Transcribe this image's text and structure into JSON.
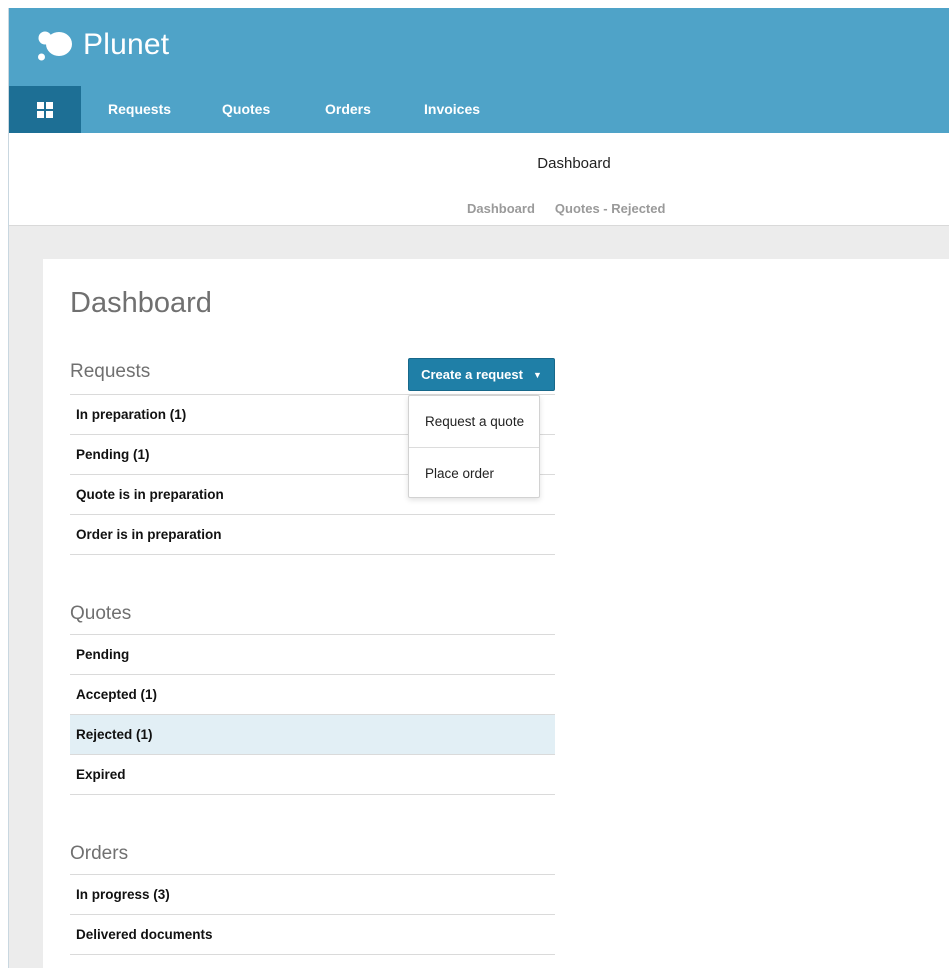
{
  "app": {
    "brand_name": "Plunet"
  },
  "nav": {
    "items": [
      {
        "label": "Requests"
      },
      {
        "label": "Quotes"
      },
      {
        "label": "Orders"
      },
      {
        "label": "Invoices"
      }
    ]
  },
  "header": {
    "title": "Dashboard",
    "breadcrumb": [
      "Dashboard",
      "Quotes - Rejected"
    ]
  },
  "main": {
    "page_title": "Dashboard",
    "create_button_label": "Create a request",
    "dropdown_items": [
      "Request a quote",
      "Place order"
    ],
    "sections": [
      {
        "title": "Requests",
        "items": [
          "In preparation (1)",
          "Pending (1)",
          "Quote is in preparation",
          "Order is in preparation"
        ]
      },
      {
        "title": "Quotes",
        "items": [
          "Pending",
          "Accepted (1)",
          "Rejected (1)",
          "Expired"
        ],
        "active": "Rejected (1)"
      },
      {
        "title": "Orders",
        "items": [
          "In progress (3)",
          "Delivered documents"
        ]
      }
    ]
  },
  "colors": {
    "brand_bar": "#4fa3c8",
    "nav_home": "#1d6f95",
    "button": "#1f7fa7",
    "active_row": "#e2eff5"
  }
}
